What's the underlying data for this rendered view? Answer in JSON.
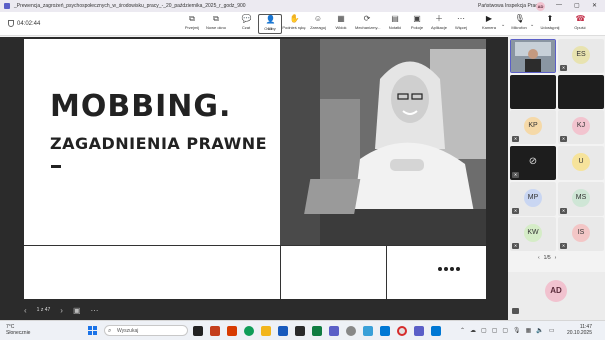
{
  "titlebar": {
    "title": "_Prewencja_zagrożeń_psychospołecznych_w_środowisku_pracy_-_20_października_2025_r_godz_900",
    "organization": "Państwowa Inspekcja Pracy",
    "user_initials": "AD",
    "minimize": "—",
    "maximize": "▢",
    "close": "✕"
  },
  "toolbar": {
    "timer": "04:02:44",
    "items": [
      {
        "label": "Przejmij",
        "icon": "⧉"
      },
      {
        "label": "Nowe okno",
        "icon": "⧉"
      },
      {
        "label": "Czat",
        "icon": "💬"
      },
      {
        "label": "Osoby",
        "icon": "👤",
        "count": "55"
      },
      {
        "label": "Podnieś rękę",
        "icon": "✋"
      },
      {
        "label": "Zareaguj",
        "icon": "☺"
      },
      {
        "label": "Widok",
        "icon": "▦"
      },
      {
        "label": "Mechanizmy...",
        "icon": "⟳"
      },
      {
        "label": "Notatki",
        "icon": "▤"
      },
      {
        "label": "Pokoje",
        "icon": "▣"
      },
      {
        "label": "Aplikacje",
        "icon": "＋"
      },
      {
        "label": "Więcej",
        "icon": "⋯"
      },
      {
        "label": "Kamera",
        "icon": "▶"
      },
      {
        "label": "Mikrofon",
        "icon": "🎙"
      },
      {
        "label": "Udostępnij",
        "icon": "⬆"
      },
      {
        "label": "Opuść",
        "icon": "☎"
      }
    ]
  },
  "slide": {
    "title": "MOBBING.",
    "subtitle": "ZAGADNIENIA PRAWNE",
    "page_indicator": "1 z 47"
  },
  "participants": {
    "tiles": [
      {
        "initials": "",
        "kind": "video"
      },
      {
        "initials": "ES",
        "kind": "avatar",
        "color": "#e8e3b0"
      },
      {
        "initials": "",
        "kind": "black"
      },
      {
        "initials": "",
        "kind": "black"
      },
      {
        "initials": "KP",
        "kind": "avatar",
        "color": "#f5d9a8"
      },
      {
        "initials": "KJ",
        "kind": "avatar",
        "color": "#f2c4cf"
      },
      {
        "initials": "",
        "kind": "camera-off"
      },
      {
        "initials": "U",
        "kind": "avatar",
        "color": "#f6e39b"
      },
      {
        "initials": "MP",
        "kind": "avatar",
        "color": "#c9d6f2"
      },
      {
        "initials": "MS",
        "kind": "avatar",
        "color": "#cfe6d6"
      },
      {
        "initials": "KW",
        "kind": "avatar",
        "color": "#d5ecc7"
      },
      {
        "initials": "IS",
        "kind": "avatar",
        "color": "#f3c6c6"
      }
    ],
    "pager": "1/5",
    "self_initials": "AD"
  },
  "taskbar": {
    "temperature": "7°C",
    "weather": "Słonecznie",
    "search_placeholder": "Wyszukaj",
    "time": "11:47",
    "date": "20.10.2025"
  }
}
